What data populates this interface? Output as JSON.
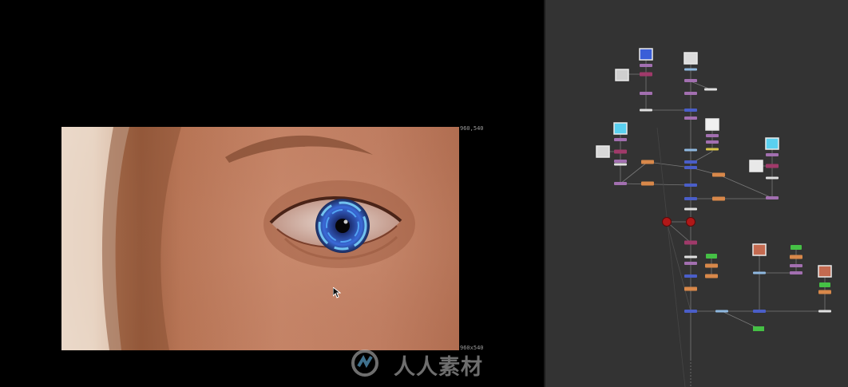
{
  "viewer": {
    "coord_top_right": "960,540",
    "coord_bottom_right": "960x540"
  },
  "watermark": {
    "text": "人人素材"
  },
  "colors": {
    "viewer_bg": "#000000",
    "nodegraph_bg": "#333333",
    "node_purple": "#a26fb0",
    "node_blue": "#4a5ec8",
    "node_orange": "#d8884a",
    "node_green": "#45c045",
    "node_red": "#b01818"
  }
}
